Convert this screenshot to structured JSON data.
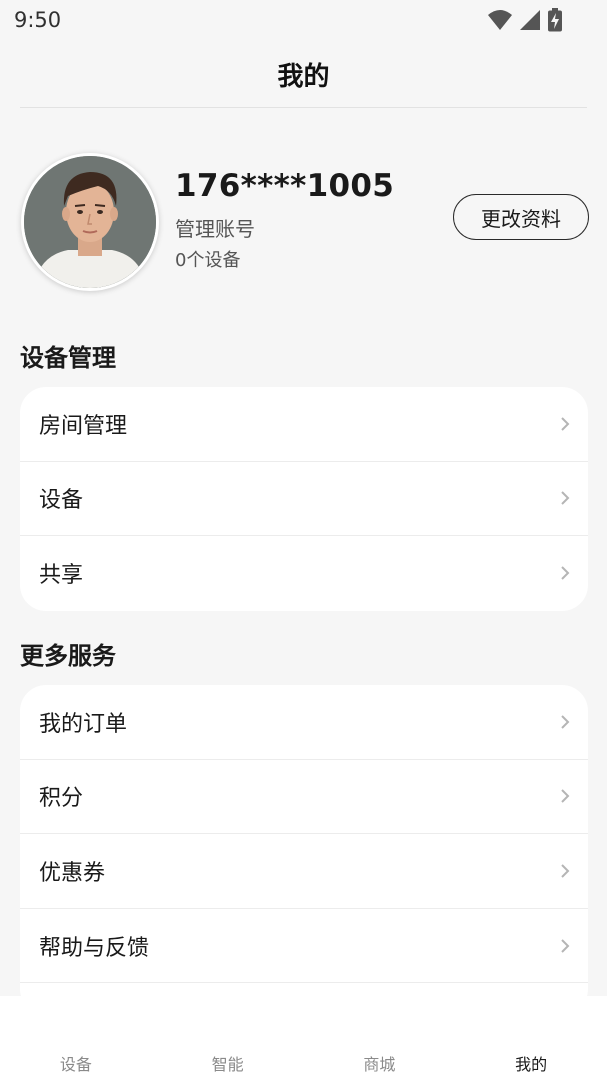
{
  "status_bar": {
    "time": "9:50",
    "icons": [
      "wifi-icon",
      "signal-icon",
      "battery-charging-icon"
    ]
  },
  "header": {
    "title": "我的"
  },
  "profile": {
    "phone": "176****1005",
    "role": "管理账号",
    "device_count": "0个设备",
    "edit_button": "更改资料"
  },
  "device_management": {
    "title": "设备管理",
    "items": [
      {
        "label": "房间管理"
      },
      {
        "label": "设备"
      },
      {
        "label": "共享"
      }
    ]
  },
  "more_services": {
    "title": "更多服务",
    "items": [
      {
        "label": "我的订单"
      },
      {
        "label": "积分"
      },
      {
        "label": "优惠券"
      },
      {
        "label": "帮助与反馈"
      }
    ]
  },
  "bottom_nav": {
    "items": [
      {
        "label": "设备"
      },
      {
        "label": "智能"
      },
      {
        "label": "商城"
      },
      {
        "label": "我的"
      }
    ],
    "active_index": 3
  },
  "colors": {
    "background": "#f6f6f6",
    "card": "#ffffff",
    "text_primary": "#1a1a1a",
    "text_secondary": "#555555",
    "nav_inactive": "#8a8a8a"
  }
}
